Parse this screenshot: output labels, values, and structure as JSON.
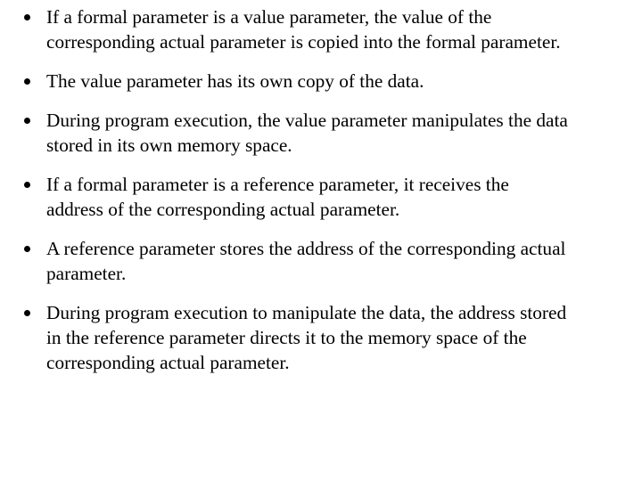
{
  "bullets": [
    {
      "lines": [
        "If a formal parameter is a value parameter, the value of the",
        "corresponding actual parameter is copied into the formal parameter."
      ]
    },
    {
      "lines": [
        "The value parameter has its own copy of the data."
      ]
    },
    {
      "lines": [
        "During program execution, the value parameter manipulates the data",
        "stored in its own memory space."
      ]
    },
    {
      "lines": [
        "If a formal parameter is a reference parameter, it receives the",
        "address of the corresponding actual parameter."
      ]
    },
    {
      "lines": [
        "A reference parameter stores the address of the corresponding actual",
        "parameter."
      ]
    },
    {
      "lines": [
        "During program execution to manipulate the data, the address stored",
        "in the reference parameter directs it to the memory space of the",
        "corresponding actual parameter."
      ]
    }
  ],
  "icons": {
    "bullet": "filled-circle-bullet"
  },
  "colors": {
    "text": "#000000",
    "background": "#ffffff"
  }
}
